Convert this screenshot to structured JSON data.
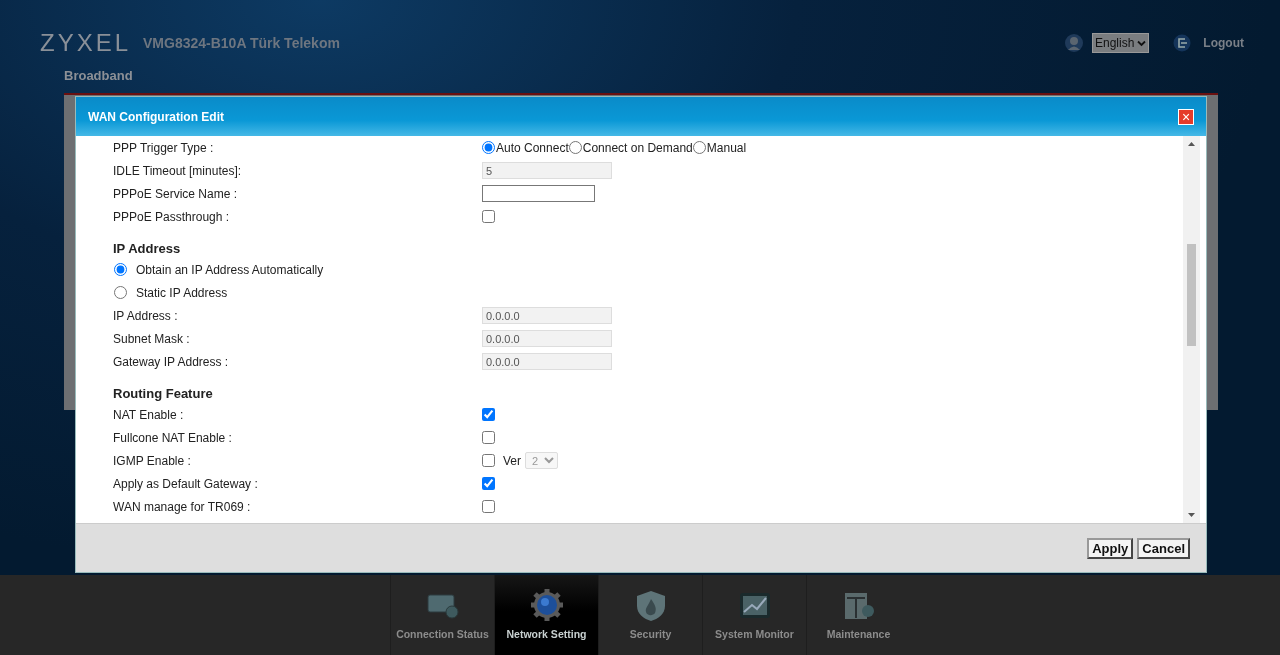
{
  "header": {
    "logo": "ZYXEL",
    "model": "VMG8324-B10A Türk Telekom",
    "language": "English",
    "logout": "Logout"
  },
  "page_title": "Broadband",
  "dialog": {
    "title": "WAN Configuration Edit",
    "close": "×",
    "rows": [
      {
        "kind": "radio_group",
        "label": "PPP Trigger Type :",
        "options": [
          {
            "label": "Auto Connect",
            "selected": true
          },
          {
            "label": "Connect on Demand",
            "selected": false
          },
          {
            "label": "Manual",
            "selected": false
          }
        ]
      },
      {
        "kind": "field",
        "label": "IDLE Timeout [minutes]:",
        "value": "5",
        "disabled": true
      },
      {
        "kind": "field",
        "label": "PPPoE Service Name :",
        "disabled": false
      },
      {
        "kind": "checkbox",
        "label": "PPPoE Passthrough :",
        "checked": false
      },
      {
        "kind": "heading",
        "label": "IP Address"
      },
      {
        "kind": "radio",
        "label": "Obtain an IP Address Automatically",
        "selected": true
      },
      {
        "kind": "radio",
        "label": "Static IP Address",
        "selected": false
      },
      {
        "kind": "field",
        "label": "IP Address :",
        "value": "0.0.0.0",
        "disabled": true
      },
      {
        "kind": "field",
        "label": "Subnet Mask :",
        "value": "0.0.0.0",
        "disabled": true
      },
      {
        "kind": "field",
        "label": "Gateway IP Address :",
        "value": "0.0.0.0",
        "disabled": true
      },
      {
        "kind": "heading",
        "label": "Routing Feature"
      },
      {
        "kind": "checkbox",
        "label": "NAT Enable :",
        "checked": true
      },
      {
        "kind": "checkbox",
        "label": "Fullcone NAT Enable :",
        "checked": false
      },
      {
        "kind": "checkbox_select",
        "label": "IGMP Enable :",
        "checked": false,
        "select_label": "Ver",
        "select_value": "2",
        "disabled": true
      },
      {
        "kind": "checkbox",
        "label": "Apply as Default Gateway :",
        "checked": true
      },
      {
        "kind": "checkbox",
        "label": "WAN manage for TR069 :",
        "checked": false
      }
    ],
    "buttons": [
      "Apply",
      "Cancel"
    ]
  },
  "nav": [
    {
      "label": "Connection Status",
      "selected": false
    },
    {
      "label": "Network Setting",
      "selected": true
    },
    {
      "label": "Security",
      "selected": false
    },
    {
      "label": "System Monitor",
      "selected": false
    },
    {
      "label": "Maintenance",
      "selected": false
    }
  ]
}
